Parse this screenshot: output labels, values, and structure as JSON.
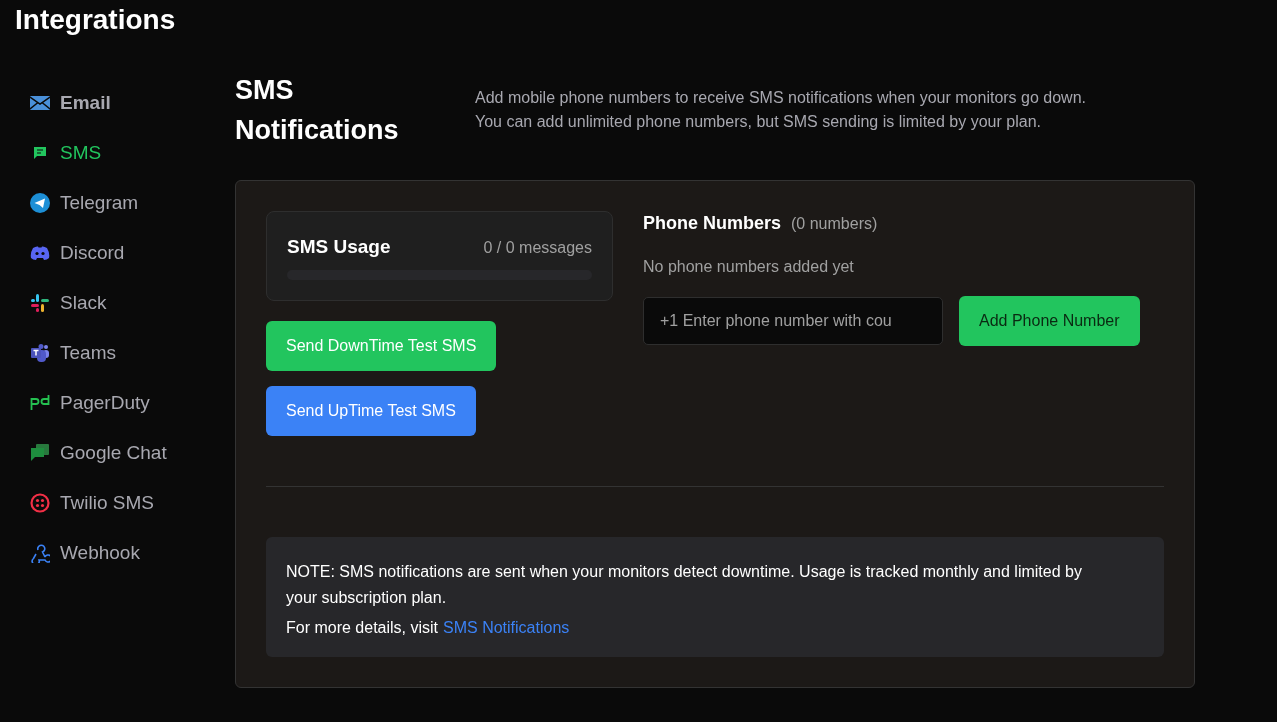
{
  "page_title": "Integrations",
  "sidebar": {
    "items": [
      {
        "kind": "email",
        "label": "Email",
        "selected": false,
        "emphasized": true
      },
      {
        "kind": "sms",
        "label": "SMS",
        "selected": true,
        "emphasized": false
      },
      {
        "kind": "telegram",
        "label": "Telegram",
        "selected": false,
        "emphasized": false
      },
      {
        "kind": "discord",
        "label": "Discord",
        "selected": false,
        "emphasized": false
      },
      {
        "kind": "slack",
        "label": "Slack",
        "selected": false,
        "emphasized": false
      },
      {
        "kind": "teams",
        "label": "Teams",
        "selected": false,
        "emphasized": false
      },
      {
        "kind": "pagerduty",
        "label": "PagerDuty",
        "selected": false,
        "emphasized": false
      },
      {
        "kind": "googlechat",
        "label": "Google Chat",
        "selected": false,
        "emphasized": false
      },
      {
        "kind": "twilio",
        "label": "Twilio SMS",
        "selected": false,
        "emphasized": false
      },
      {
        "kind": "webhook",
        "label": "Webhook",
        "selected": false,
        "emphasized": false
      }
    ]
  },
  "header": {
    "title": "SMS Notifications",
    "description": [
      "Add mobile phone numbers to receive SMS notifications when your monitors go down.",
      "You can add unlimited phone numbers, but SMS sending is limited by your plan."
    ]
  },
  "usage": {
    "title": "SMS Usage",
    "reading": "0 / 0 messages",
    "level": 0
  },
  "test_buttons": [
    {
      "kind": "down",
      "label": "Send DownTime Test SMS"
    },
    {
      "kind": "up",
      "label": "Send UpTime Test SMS"
    }
  ],
  "phone_numbers": {
    "title": "Phone Numbers",
    "count": "(0 numbers)",
    "empty_text": "No phone numbers added yet",
    "placeholder": "+1 Enter phone number with cou",
    "add_button": "Add Phone Number"
  },
  "note": {
    "text": "NOTE: SMS notifications are sent when your monitors detect downtime. Usage is tracked monthly and limited by your subscription plan.",
    "more_prefix": "For more details, visit",
    "link": "SMS Notifications"
  }
}
